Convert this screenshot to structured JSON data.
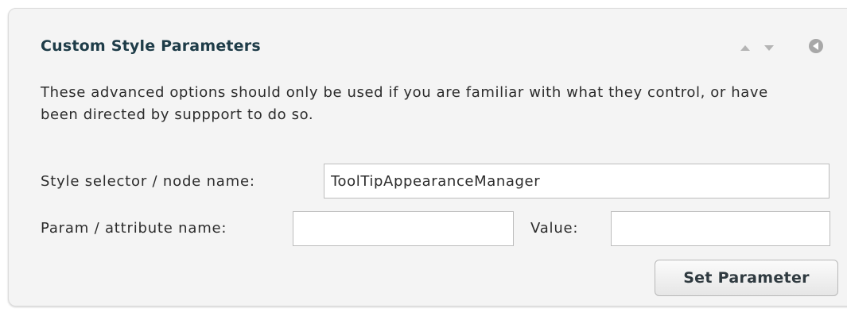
{
  "panel": {
    "title": "Custom Style Parameters",
    "description": "These advanced options should only be used if you are familiar with what they control, or have been directed by suppport to do so."
  },
  "controls": {
    "move_up_icon": "triangle-up",
    "move_down_icon": "triangle-down",
    "collapse_icon": "circle-left-arrow"
  },
  "form": {
    "selector_label": "Style selector / node name:",
    "selector_value": "ToolTipAppearanceManager",
    "param_label": "Param / attribute name:",
    "param_value": "",
    "value_label": "Value:",
    "value_value": "",
    "submit_label": "Set Parameter"
  }
}
